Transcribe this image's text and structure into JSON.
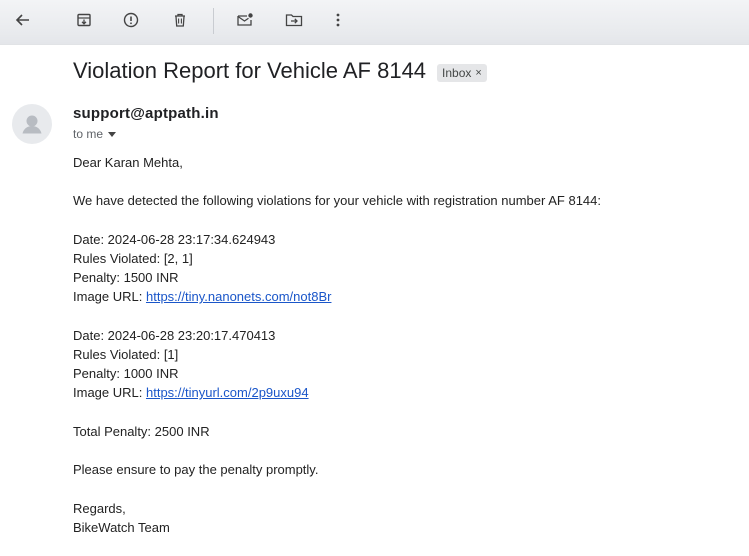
{
  "toolbar": {
    "icons": [
      "back-arrow-icon",
      "archive-icon",
      "report-spam-icon",
      "delete-icon",
      "mark-unread-icon",
      "move-to-icon",
      "more-vert-icon"
    ]
  },
  "email": {
    "subject": "Violation Report for Vehicle AF 8144",
    "label": "Inbox",
    "label_close": "×",
    "sender": "support@aptpath.in",
    "recipient": "to me",
    "greeting": "Dear Karan Mehta,",
    "intro": "We have detected the following violations for your vehicle with registration number AF 8144:",
    "violations": [
      {
        "date": "Date: 2024-06-28 23:17:34.624943",
        "rules": "Rules Violated: [2, 1]",
        "penalty": "Penalty: 1500 INR",
        "image_label": "Image URL: ",
        "image_url": "https://tiny.nanonets.com/not8Br"
      },
      {
        "date": "Date: 2024-06-28 23:20:17.470413",
        "rules": "Rules Violated: [1]",
        "penalty": "Penalty: 1000 INR",
        "image_label": "Image URL: ",
        "image_url": "https://tinyurl.com/2p9uxu94"
      }
    ],
    "total": "Total Penalty: 2500 INR",
    "request": "Please ensure to pay the penalty promptly.",
    "signoff": "Regards,",
    "team": "BikeWatch Team"
  }
}
